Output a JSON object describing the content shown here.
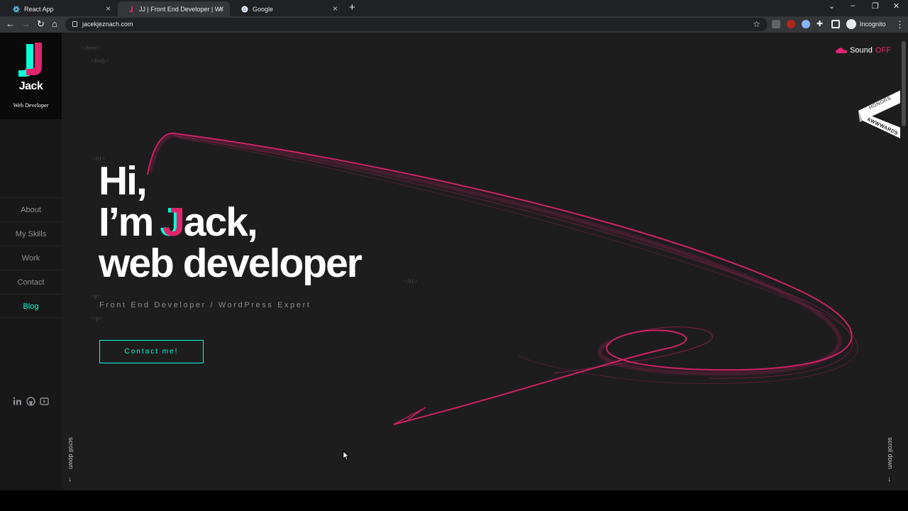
{
  "browser": {
    "tabs": [
      {
        "title": "React App",
        "active": false
      },
      {
        "title": "JJ | Front End Developer | WordP...",
        "active": true
      },
      {
        "title": "Google",
        "active": false
      }
    ],
    "url": "jacekjeznach.com",
    "profile_label": "Incognito"
  },
  "sidebar": {
    "logo_letter": "J",
    "logo_name": "Jack",
    "logo_subtitle": "Web Developer",
    "nav": [
      {
        "label": "About"
      },
      {
        "label": "My Skills"
      },
      {
        "label": "Work"
      },
      {
        "label": "Contact"
      },
      {
        "label": "Blog"
      }
    ]
  },
  "tags": {
    "html": "</html>",
    "body": "<body>",
    "h1_open": "<h1>",
    "h1_close": "</h1>",
    "p_open": "<p>",
    "p_close": "</p>"
  },
  "hero": {
    "line1": "Hi,",
    "line2_pre": "I’m ",
    "line2_j": "J",
    "line2_post": "ack,",
    "line3": "web developer",
    "subtitle": "Front End Developer / WordPress Expert",
    "cta": "Contact me!"
  },
  "sound": {
    "label": "Sound",
    "state": "OFF"
  },
  "award": {
    "line1": "HONORS",
    "line2": "AWWWARDS"
  },
  "scroll_label": "scroll down",
  "colors": {
    "accent": "#e2246c",
    "teal": "#08fdd8",
    "background": "#1d1d1d"
  }
}
